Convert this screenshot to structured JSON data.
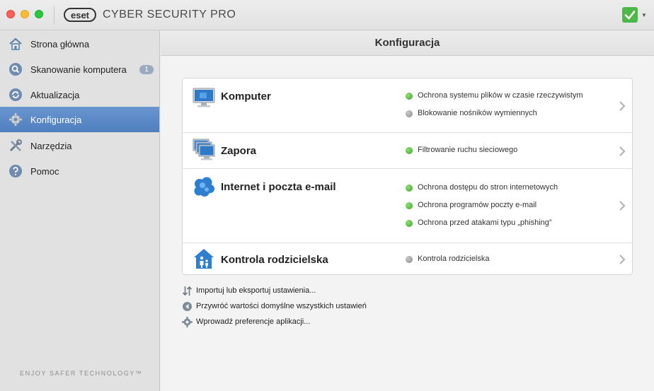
{
  "window": {
    "app_title": "CYBER SECURITY PRO",
    "brand_logo_text": "eset",
    "status_color": "#4db848"
  },
  "sidebar": {
    "items": [
      {
        "label": "Strona główna",
        "icon": "home-icon"
      },
      {
        "label": "Skanowanie komputera",
        "icon": "magnifier-icon",
        "badge": "1"
      },
      {
        "label": "Aktualizacja",
        "icon": "update-icon"
      },
      {
        "label": "Konfiguracja",
        "icon": "gear-icon",
        "active": true
      },
      {
        "label": "Narzędzia",
        "icon": "tools-icon"
      },
      {
        "label": "Pomoc",
        "icon": "help-icon"
      }
    ],
    "tagline": "ENJOY SAFER TECHNOLOGY™",
    "active_color": "#5a88c8"
  },
  "main": {
    "title": "Konfiguracja",
    "sections": [
      {
        "title": "Komputer",
        "icon": "monitor-icon",
        "features": [
          {
            "label": "Ochrona systemu plików w czasie rzeczywistym",
            "status": "on"
          },
          {
            "label": "Blokowanie nośników wymiennych",
            "status": "off"
          }
        ]
      },
      {
        "title": "Zapora",
        "icon": "firewall-monitors-icon",
        "features": [
          {
            "label": "Filtrowanie ruchu sieciowego",
            "status": "on"
          }
        ]
      },
      {
        "title": "Internet i poczta e-mail",
        "icon": "cloud-icon",
        "features": [
          {
            "label": "Ochrona dostępu do stron internetowych",
            "status": "on"
          },
          {
            "label": "Ochrona programów poczty e-mail",
            "status": "on"
          },
          {
            "label": "Ochrona przed atakami typu „phishing”",
            "status": "on"
          }
        ]
      },
      {
        "title": "Kontrola rodzicielska",
        "icon": "parental-house-icon",
        "features": [
          {
            "label": "Kontrola rodzicielska",
            "status": "off"
          }
        ]
      }
    ],
    "links": [
      {
        "label": "Importuj lub eksportuj ustawienia...",
        "icon": "import-export-icon"
      },
      {
        "label": "Przywróć wartości domyślne wszystkich ustawień",
        "icon": "restore-icon"
      },
      {
        "label": "Wprowadź preferencje aplikacji...",
        "icon": "gear-icon"
      }
    ],
    "status_colors": {
      "on": "#3aa52a",
      "off": "#8a8a8a"
    }
  }
}
